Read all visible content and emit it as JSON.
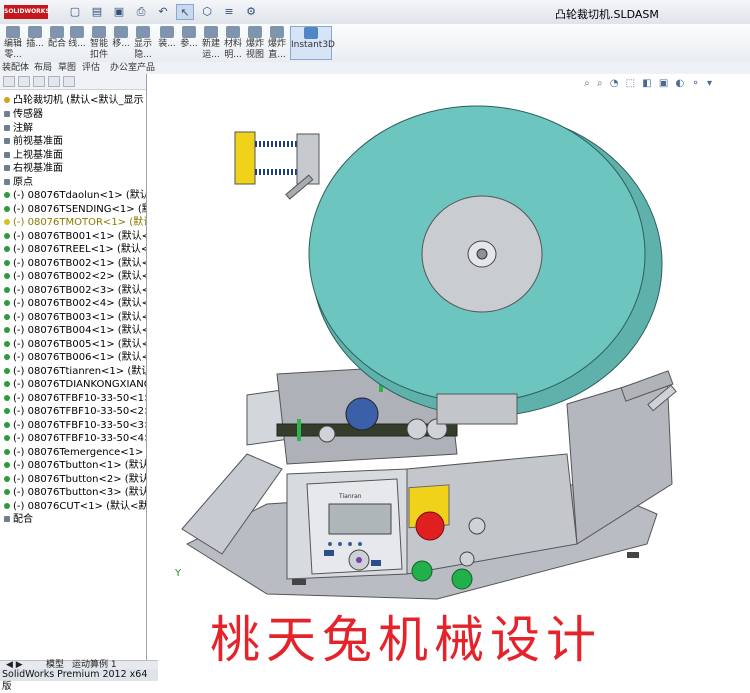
{
  "app": {
    "logo_text": "SOLIDWORKS",
    "document_title": "凸轮裁切机.SLDASM"
  },
  "ribbon": {
    "buttons": [
      {
        "label": "编辑\n零...",
        "icon": "edit-component-icon"
      },
      {
        "label": "插...",
        "icon": "insert-component-icon"
      },
      {
        "label": "配合",
        "icon": "mate-icon"
      },
      {
        "label": "线...",
        "icon": "linear-pattern-icon"
      },
      {
        "label": "智能\n扣件",
        "icon": "smart-fasteners-icon"
      },
      {
        "label": "移...",
        "icon": "move-component-icon"
      },
      {
        "label": "显示\n隐...",
        "icon": "show-hidden-icon"
      },
      {
        "label": "装...",
        "icon": "assembly-features-icon"
      },
      {
        "label": "参...",
        "icon": "reference-geometry-icon"
      },
      {
        "label": "新建\n运...",
        "icon": "new-motion-study-icon"
      },
      {
        "label": "材料\n明...",
        "icon": "bill-of-materials-icon"
      },
      {
        "label": "爆炸\n视图",
        "icon": "exploded-view-icon"
      },
      {
        "label": "爆炸\n直...",
        "icon": "explode-line-sketch-icon"
      },
      {
        "label": "Instant3D",
        "icon": "instant3d-icon"
      }
    ]
  },
  "tabs_row": [
    "装配体",
    "布局",
    "草图",
    "评估",
    "办公室产品"
  ],
  "tree": {
    "root": "凸轮裁切机 (默认<默认_显示",
    "items": [
      {
        "label": "传感器",
        "style": "plain"
      },
      {
        "label": "注解",
        "style": "plain"
      },
      {
        "label": "前视基准面",
        "style": "plain"
      },
      {
        "label": "上视基准面",
        "style": "plain"
      },
      {
        "label": "右视基准面",
        "style": "plain"
      },
      {
        "label": "原点",
        "style": "plain"
      },
      {
        "label": "(-) 08076Tdaolun<1> (默认<",
        "style": "part"
      },
      {
        "label": "(-) 08076TSENDING<1> (默认",
        "style": "part"
      },
      {
        "label": "(-) 08076TMOTOR<1> (默认",
        "style": "yellow"
      },
      {
        "label": "(-) 08076TB001<1> (默认<<",
        "style": "part"
      },
      {
        "label": "(-) 08076TREEL<1> (默认<默",
        "style": "part"
      },
      {
        "label": "(-) 08076TB002<1> (默认<<",
        "style": "part"
      },
      {
        "label": "(-) 08076TB002<2> (默认<<",
        "style": "part"
      },
      {
        "label": "(-) 08076TB002<3> (默认<<",
        "style": "part"
      },
      {
        "label": "(-) 08076TB002<4> (默认<<",
        "style": "part"
      },
      {
        "label": "(-) 08076TB003<1> (默认<<",
        "style": "part"
      },
      {
        "label": "(-) 08076TB004<1> (默认<<",
        "style": "part"
      },
      {
        "label": "(-) 08076TB005<1> (默认<<",
        "style": "part"
      },
      {
        "label": "(-) 08076TB006<1> (默认<<",
        "style": "part"
      },
      {
        "label": "(-) 08076Ttianren<1> (默认<",
        "style": "part"
      },
      {
        "label": "(-) 08076TDIANKONGXIANG",
        "style": "part"
      },
      {
        "label": "(-) 08076TFBF10-33-50<1>",
        "style": "part"
      },
      {
        "label": "(-) 08076TFBF10-33-50<2>",
        "style": "part"
      },
      {
        "label": "(-) 08076TFBF10-33-50<3>",
        "style": "part"
      },
      {
        "label": "(-) 08076TFBF10-33-50<4>",
        "style": "part"
      },
      {
        "label": "(-) 08076Temergence<1> (默",
        "style": "part"
      },
      {
        "label": "(-) 08076Tbutton<1> (默认<",
        "style": "part"
      },
      {
        "label": "(-) 08076Tbutton<2> (默认<",
        "style": "part"
      },
      {
        "label": "(-) 08076Tbutton<3> (默认<",
        "style": "part"
      },
      {
        "label": "(-) 08076CUT<1> (默认<默认",
        "style": "part"
      },
      {
        "label": "配合",
        "style": "plain"
      }
    ]
  },
  "model": {
    "panel_brand": "Tianran",
    "key_labels": [
      "ESC",
      "ENT"
    ]
  },
  "bottom_tabs": [
    "模型",
    "运动算例 1"
  ],
  "status": "SolidWorks Premium 2012 x64 版",
  "watermark": "桃天兔机械设计",
  "colors": {
    "reel": "#6cc6bf",
    "frame": "#c9ccd1",
    "estop": "#e02020",
    "green_button": "#21b14b",
    "watermark": "#e4232b"
  }
}
